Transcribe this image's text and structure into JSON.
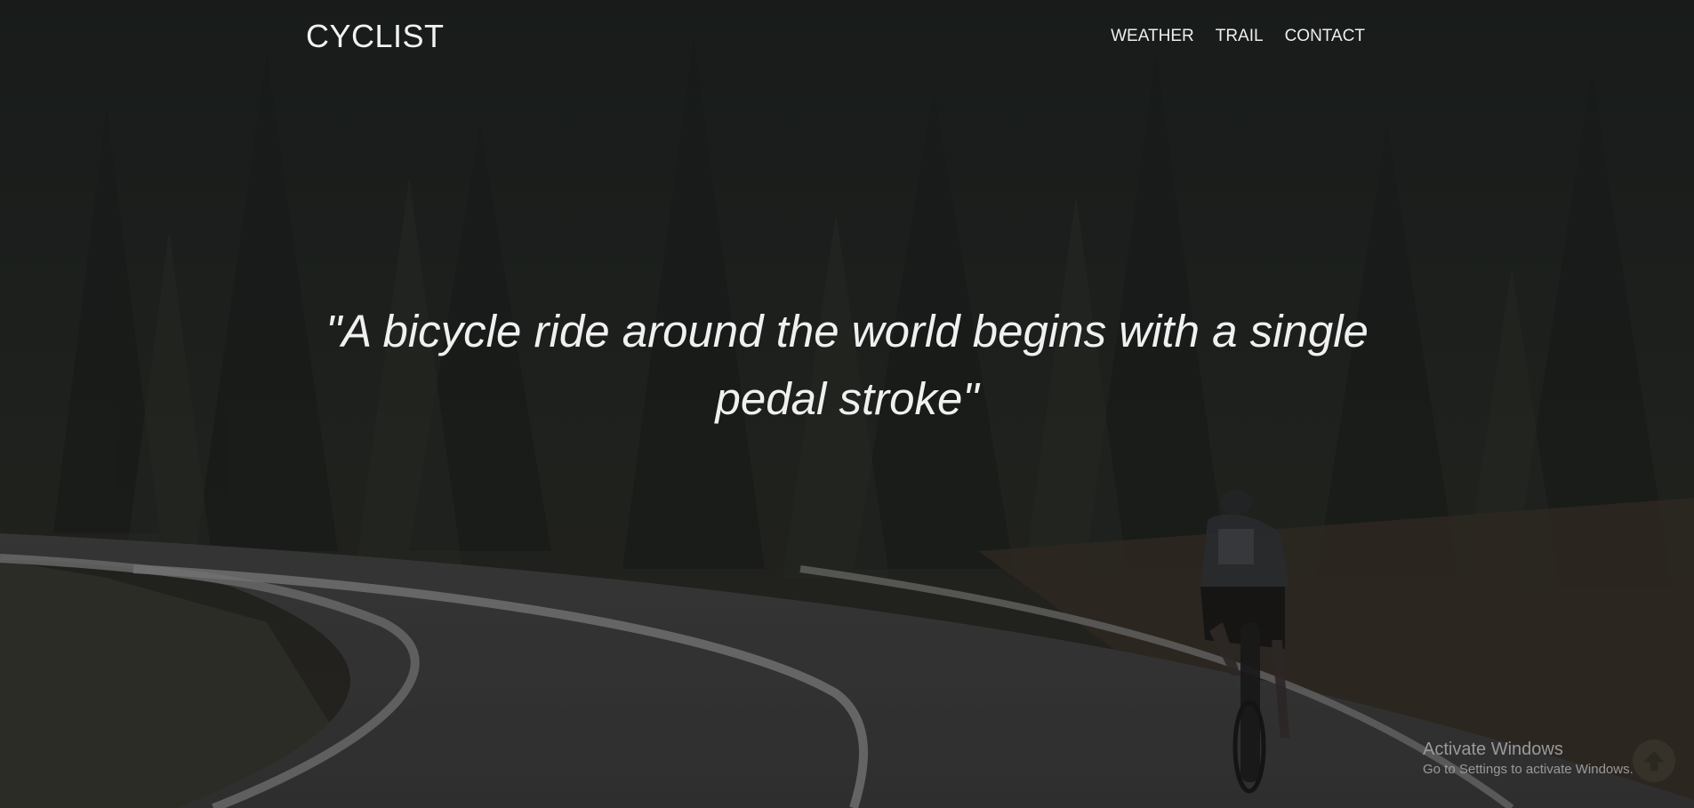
{
  "header": {
    "brand": "CYCLIST",
    "nav": [
      "WEATHER",
      "TRAIL",
      "CONTACT"
    ]
  },
  "hero": {
    "quote_line1": "\"A bicycle ride around the world begins with a single",
    "quote_line2": "pedal stroke\""
  },
  "watermark": {
    "title": "Activate Windows",
    "subtitle": "Go to Settings to activate Windows."
  },
  "icons": {
    "scroll_top": "arrow-up-icon"
  },
  "colors": {
    "text": "#f0f0f0",
    "overlay": "#141414",
    "road": "#4a4a4a",
    "forest": "#1f2520"
  }
}
